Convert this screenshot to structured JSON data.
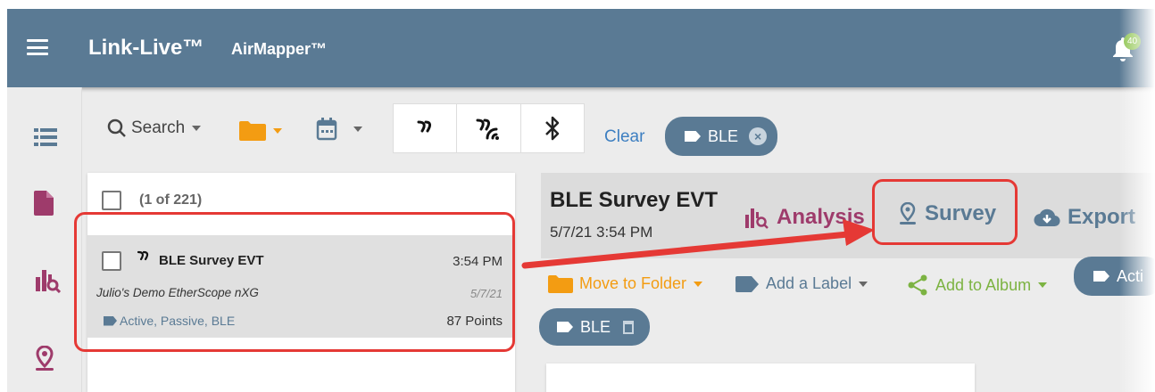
{
  "header": {
    "brand": "Link-Live™",
    "app_name": "AirMapper™",
    "notification_count": "40"
  },
  "sidebar": {
    "items": [
      {
        "icon": "list-icon"
      },
      {
        "icon": "document-icon"
      },
      {
        "icon": "analysis-icon"
      },
      {
        "icon": "location-pin-icon"
      }
    ]
  },
  "filters": {
    "search_label": "Search",
    "clear_label": "Clear",
    "chip_label": "BLE",
    "chip_remove": "×"
  },
  "list": {
    "count_label": "(1 of 221)",
    "rows": [
      {
        "name": "BLE Survey EVT",
        "time": "3:54 PM",
        "device": "Julio's Demo EtherScope nXG",
        "date": "5/7/21",
        "tags": "Active, Passive, BLE",
        "points": "87 Points"
      }
    ]
  },
  "detail": {
    "title": "BLE Survey EVT",
    "datetime": "5/7/21 3:54 PM",
    "analysis_label": "Analysis",
    "survey_label": "Survey",
    "export_label": "Export",
    "move_folder_label": "Move to Folder",
    "add_label_label": "Add a Label",
    "add_album_label": "Add to Album",
    "active_chip_label": "Acti",
    "label_chip": "BLE"
  },
  "colors": {
    "header": "#5a7a94",
    "accent_red": "#e53935",
    "analysis": "#9e3b6b",
    "folder": "#f39c12",
    "album": "#7cb342",
    "link": "#3d7fc1"
  }
}
